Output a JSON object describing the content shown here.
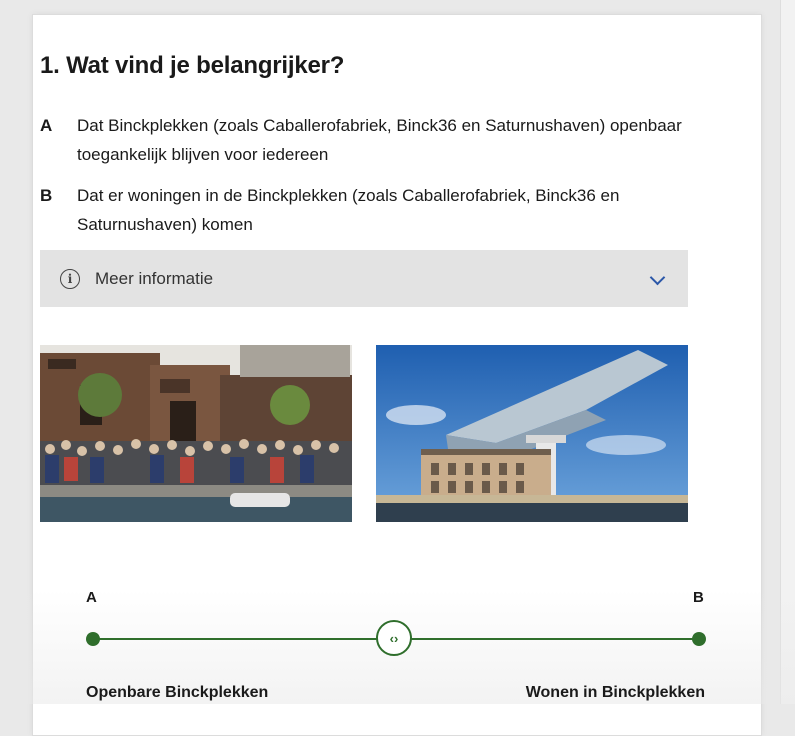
{
  "question": {
    "title": "1. Wat vind je belangrijker?",
    "options": [
      {
        "key": "A",
        "text": "Dat Binckplekken (zoals Caballerofabriek, Binck36 en Saturnushaven) openbaar toegankelijk blijven voor iedereen"
      },
      {
        "key": "B",
        "text": "Dat er woningen in de Binckplekken (zoals Caballerofabriek, Binck36 en Saturnushaven) komen"
      }
    ]
  },
  "info": {
    "label": "Meer informatie",
    "icon": "info-circle-icon",
    "toggle_icon": "chevron-down-icon"
  },
  "images": {
    "left": "crowd-at-waterfront-building",
    "right": "modern-glass-building-on-old-harbour"
  },
  "slider": {
    "end_a": "A",
    "end_b": "B",
    "handle_glyph": "‹›",
    "position": 0.5,
    "label_a": "Openbare Binckplekken",
    "label_b": "Wonen in Binckplekken",
    "accent": "#2f6e2c"
  },
  "colors": {
    "chevron": "#2b57a8",
    "info_bar_bg": "#e3e3e3"
  }
}
